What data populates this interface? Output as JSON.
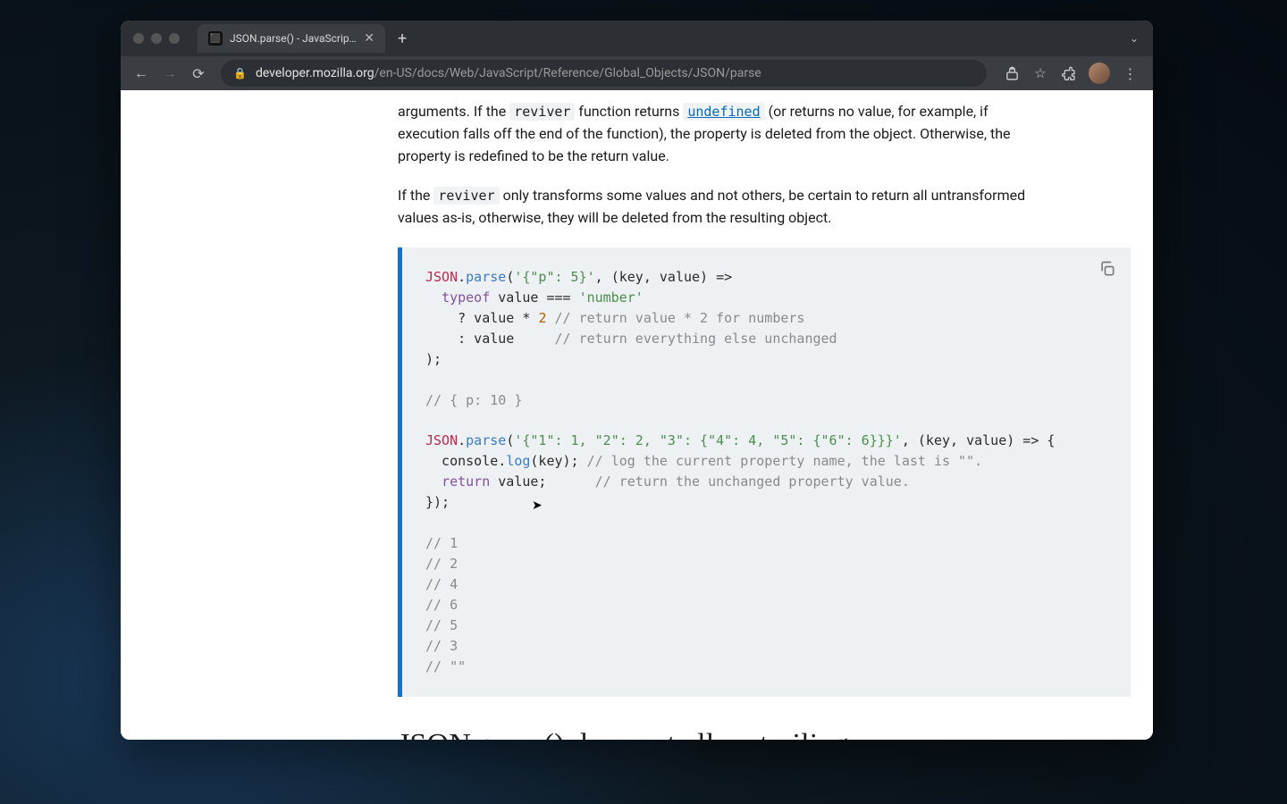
{
  "tab": {
    "title": "JSON.parse() - JavaScript | MDN"
  },
  "url": {
    "host": "developer.mozilla.org",
    "path": "/en-US/docs/Web/JavaScript/Reference/Global_Objects/JSON/parse"
  },
  "para1": {
    "pre": "arguments. If the ",
    "code1": "reviver",
    "mid1": " function returns ",
    "link": "undefined",
    "post": " (or returns no value, for example, if execution falls off the end of the function), the property is deleted from the object. Otherwise, the property is redefined to be the return value."
  },
  "para2": {
    "pre": "If the ",
    "code1": "reviver",
    "post": " only transforms some values and not others, be certain to return all untransformed values as-is, otherwise, they will be deleted from the resulting object."
  },
  "code": {
    "l1_obj": "JSON",
    "l1_dot": ".",
    "l1_meth": "parse",
    "l1_open": "(",
    "l1_str": "'{\"p\": 5}'",
    "l1_rest": ", (key, value) =>",
    "l2_ind": "  ",
    "l2_kw": "typeof",
    "l2_rest": " value === ",
    "l2_str": "'number'",
    "l3_ind": "    ? value * ",
    "l3_num": "2",
    "l3_sp": " ",
    "l3_cmt": "// return value * 2 for numbers",
    "l4_ind": "    : value     ",
    "l4_cmt": "// return everything else unchanged",
    "l5": ");",
    "l6": "",
    "l7_cmt": "// { p: 10 }",
    "l8": "",
    "l9_obj": "JSON",
    "l9_dot": ".",
    "l9_meth": "parse",
    "l9_open": "(",
    "l9_str": "'{\"1\": 1, \"2\": 2, \"3\": {\"4\": 4, \"5\": {\"6\": 6}}}'",
    "l9_rest": ", (key, value) => {",
    "l10_ind": "  console.",
    "l10_meth": "log",
    "l10_rest": "(key); ",
    "l10_cmt": "// log the current property name, the last is \"\".",
    "l11_ind": "  ",
    "l11_kw": "return",
    "l11_rest": " value;      ",
    "l11_cmt": "// return the unchanged property value.",
    "l12": "});",
    "l13": "",
    "l14_cmt": "// 1",
    "l15_cmt": "// 2",
    "l16_cmt": "// 4",
    "l17_cmt": "// 6",
    "l18_cmt": "// 5",
    "l19_cmt": "// 3",
    "l20_cmt": "// \"\""
  },
  "heading": "JSON.parse() does not allow trailing commas"
}
